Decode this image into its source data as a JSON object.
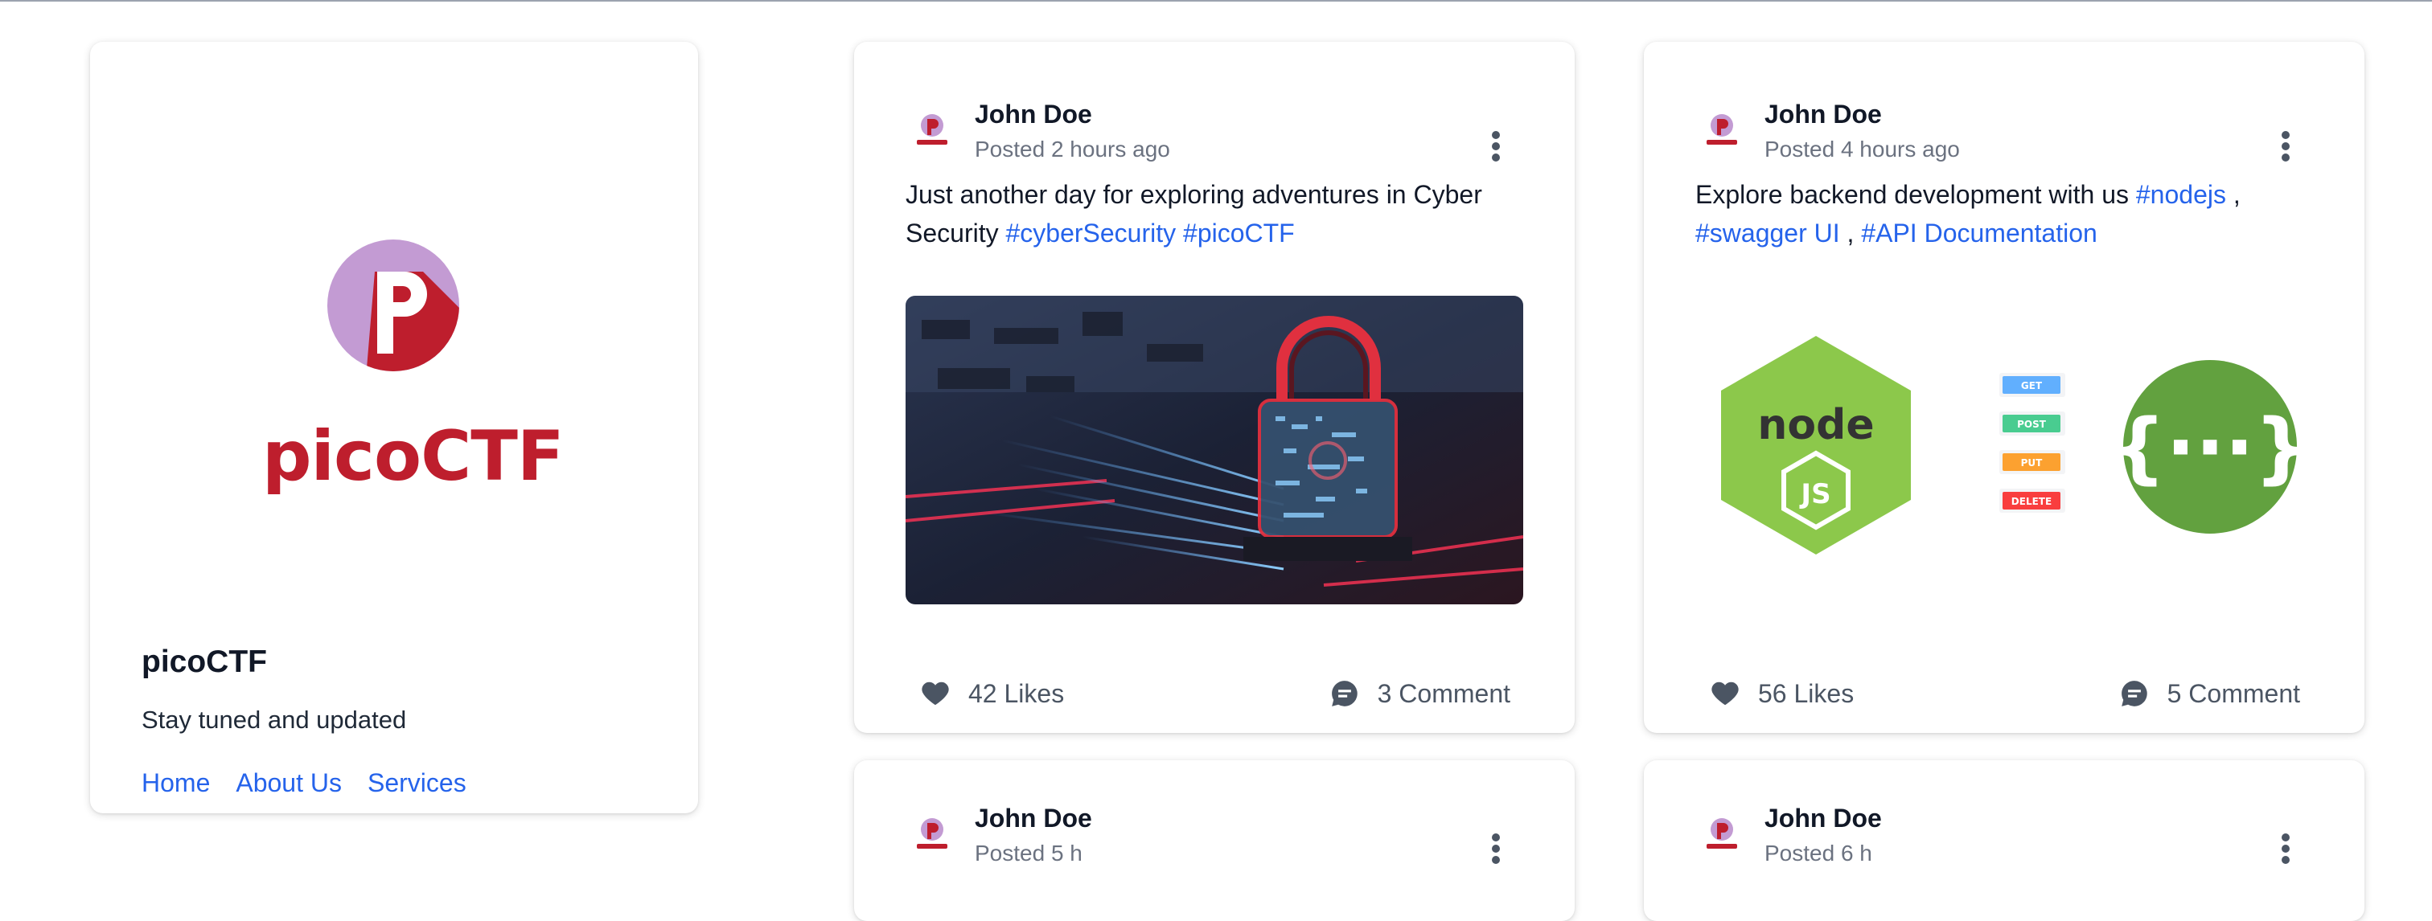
{
  "profile": {
    "logo_text": "picoCTF",
    "name": "picoCTF",
    "tagline": "Stay tuned and updated",
    "links": [
      "Home",
      "About Us",
      "Services"
    ]
  },
  "posts": [
    {
      "author": "John Doe",
      "posted": "Posted 2 hours ago",
      "text": "Just another day for exploring adventures in Cyber Security",
      "tags": [
        "#cyberSecurity",
        "#picoCTF"
      ],
      "likes": "42 Likes",
      "comments": "3 Comment"
    },
    {
      "author": "John Doe",
      "posted": "Posted 4 hours ago",
      "text": "Explore backend development with us",
      "tags": [
        "#nodejs",
        "#swagger UI",
        "#API Documentation"
      ],
      "separator": ",",
      "media_labels": {
        "node_word": "node",
        "js": "JS",
        "methods": [
          "GET",
          "POST",
          "PUT",
          "DELETE"
        ],
        "swagger": "{···}"
      },
      "likes": "56 Likes",
      "comments": "5 Comment"
    },
    {
      "author": "John Doe",
      "posted": "Posted 5 h"
    },
    {
      "author": "John Doe",
      "posted": "Posted 6 h"
    }
  ],
  "colors": {
    "brand_red": "#be1e2d",
    "brand_purple": "#c39bd3",
    "link_blue": "#2563eb",
    "node_green": "#8cc84b",
    "swagger_green": "#62a13f"
  }
}
